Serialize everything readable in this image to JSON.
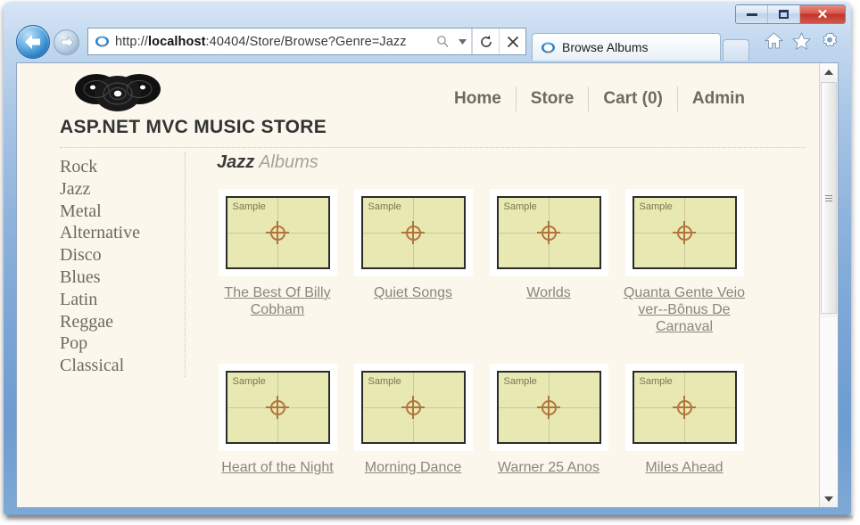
{
  "browser": {
    "window_controls": {
      "minimize": "minimize-button",
      "maximize": "restore-button",
      "close": "close-button"
    },
    "back_button": "back-icon",
    "forward_button": "forward-icon",
    "address": {
      "url_protocol_prefix": "http://",
      "url_host_bold": "localhost",
      "url_rest": ":40404/Store/Browse?Genre=Jazz",
      "full_url": "http://localhost:40404/Store/Browse?Genre=Jazz",
      "search_icon": "search-icon",
      "dropdown_icon": "chevron-down-icon",
      "refresh_icon": "refresh-icon",
      "stop_icon": "stop-x-icon"
    },
    "tab": {
      "label": "Browse Albums",
      "favicon": "internet-explorer-icon"
    },
    "new_tab": "new-tab-button",
    "toolbar": {
      "home": "home-icon",
      "favorites": "star-icon",
      "settings": "gear-icon"
    }
  },
  "site": {
    "logo": "vinyl-records-logo",
    "title": "ASP.NET MVC MUSIC STORE",
    "nav": [
      {
        "label": "Home"
      },
      {
        "label": "Store"
      },
      {
        "label": "Cart (0)"
      },
      {
        "label": "Admin"
      }
    ]
  },
  "sidebar": {
    "genres": [
      {
        "label": "Rock"
      },
      {
        "label": "Jazz"
      },
      {
        "label": "Metal"
      },
      {
        "label": "Alternative"
      },
      {
        "label": "Disco"
      },
      {
        "label": "Blues"
      },
      {
        "label": "Latin"
      },
      {
        "label": "Reggae"
      },
      {
        "label": "Pop"
      },
      {
        "label": "Classical"
      }
    ]
  },
  "main": {
    "heading_genre": "Jazz",
    "heading_suffix": "Albums",
    "thumb_sample_label": "Sample",
    "albums": [
      {
        "title": "The Best Of Billy Cobham"
      },
      {
        "title": "Quiet Songs"
      },
      {
        "title": "Worlds"
      },
      {
        "title": "Quanta Gente Veio ver--Bônus De Carnaval"
      },
      {
        "title": "Heart of the Night"
      },
      {
        "title": "Morning Dance"
      },
      {
        "title": "Warner 25 Anos"
      },
      {
        "title": "Miles Ahead"
      }
    ]
  },
  "colors": {
    "page_background": "#fbf7ec",
    "thumb_fill": "#e7e8b2",
    "link": "#8d867a",
    "nav_text": "#6f6a5e",
    "genre_text": "#6e6a5c",
    "window_chrome": "#7ba6d6"
  }
}
